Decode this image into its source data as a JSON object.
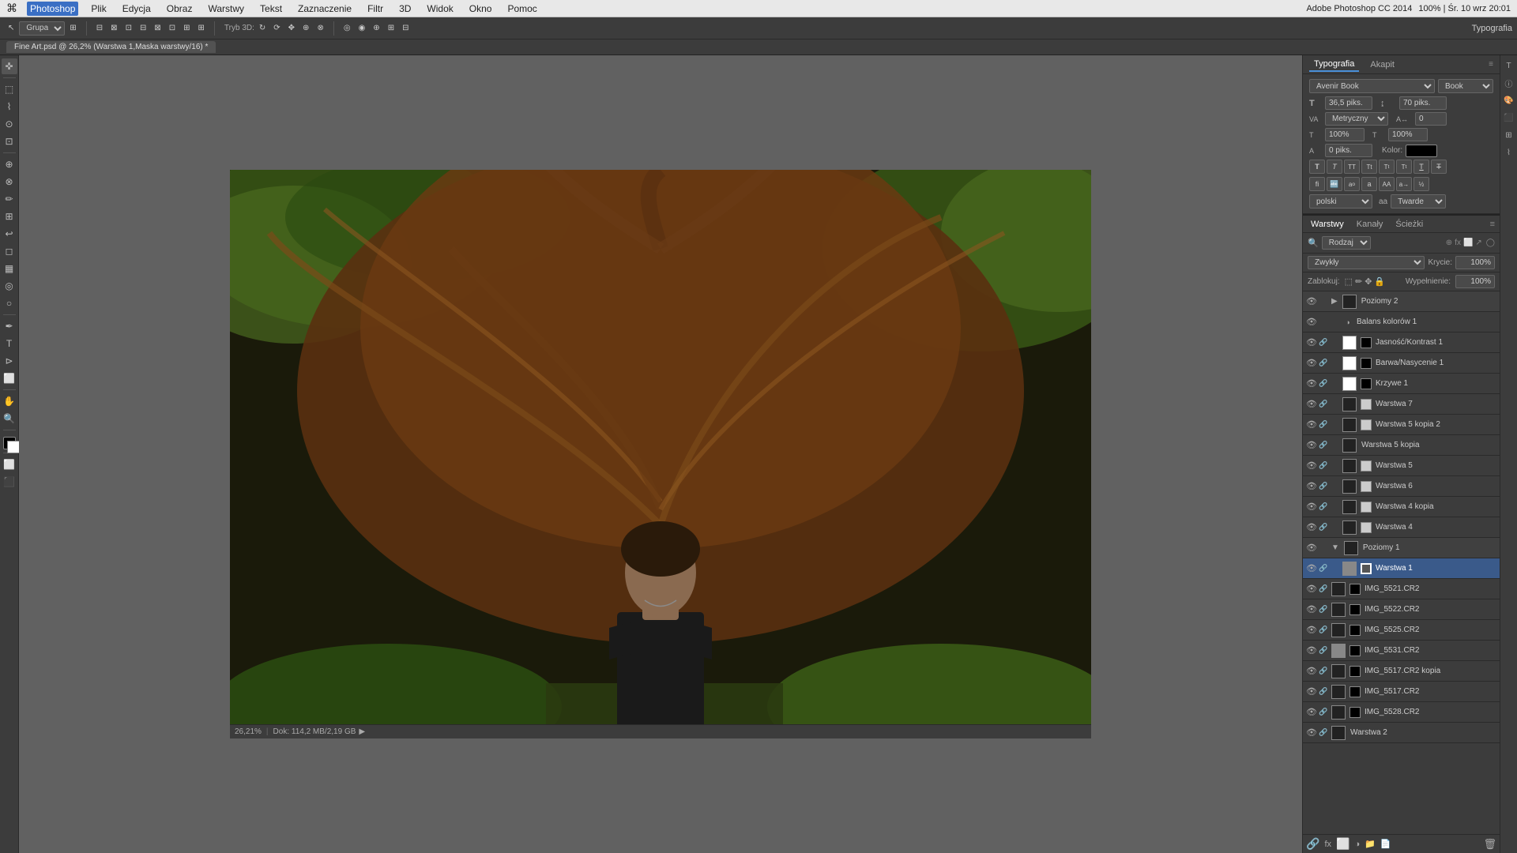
{
  "app": {
    "name": "Photoshop",
    "title": "Adobe Photoshop CC 2014",
    "workspace": "Typografia"
  },
  "menubar": {
    "apple": "⌘",
    "items": [
      "Photoshop",
      "Plik",
      "Edycja",
      "Obraz",
      "Warstwy",
      "Tekst",
      "Zaznaczenie",
      "Filtr",
      "3D",
      "Widok",
      "Okno",
      "Pomoc"
    ],
    "right": "100% | Śr. 10 wrz 20:01"
  },
  "toolbar": {
    "mode": "Tryb 3D:",
    "group_label": "Grupa"
  },
  "doctab": {
    "label": "Fine Art.psd @ 26,2% (Warstwa 1,Maska warstwy/16) *"
  },
  "statusbar": {
    "zoom": "26,21%",
    "doc_info": "Dok: 114,2 MB/2,19 GB"
  },
  "typography_panel": {
    "title": "Typografia",
    "tabs": [
      "Typografia",
      "Akapit"
    ],
    "font": "Avenir Book",
    "style": "Book",
    "size": "36,5 piks.",
    "leading": "70 piks.",
    "kern": "Metryczny",
    "track": "0",
    "scale_h": "100%",
    "scale_v": "100%",
    "baseline": "0 piks.",
    "color_label": "Kolor:",
    "language": "polski",
    "aa_method": "Twarde",
    "text_styles": [
      "T",
      "T",
      "T",
      "T",
      "T",
      "T",
      "T",
      "T"
    ],
    "text_styles2": [
      "a",
      "a",
      "a",
      "a",
      "a",
      "a",
      "1/2"
    ]
  },
  "layers_panel": {
    "tabs": [
      "Warstwy",
      "Kanały",
      "Ścieżki"
    ],
    "search_placeholder": "Rodzaj",
    "blend_mode": "Zwykły",
    "opacity": "100%",
    "fill": "100%",
    "lock_label": "Zablokuj:",
    "layers": [
      {
        "name": "Poziomy 2",
        "type": "group",
        "visible": true,
        "indent": 0
      },
      {
        "name": "Balans kolorów 1",
        "type": "adjustment",
        "visible": true,
        "indent": 1
      },
      {
        "name": "Jasność/Kontrast 1",
        "type": "adjustment",
        "visible": true,
        "indent": 1,
        "has_thumb": true
      },
      {
        "name": "Barwa/Nasycenie 1",
        "type": "adjustment",
        "visible": true,
        "indent": 1,
        "has_thumb": true
      },
      {
        "name": "Krzywe 1",
        "type": "adjustment",
        "visible": true,
        "indent": 1,
        "has_thumb": true
      },
      {
        "name": "Warstwa 7",
        "type": "normal",
        "visible": true,
        "indent": 1,
        "has_mask": true
      },
      {
        "name": "Warstwa 5 kopia 2",
        "type": "normal",
        "visible": true,
        "indent": 1,
        "has_mask": true
      },
      {
        "name": "Warstwa 5 kopia",
        "type": "normal",
        "visible": true,
        "indent": 1
      },
      {
        "name": "Warstwa 5",
        "type": "normal",
        "visible": true,
        "indent": 1,
        "has_mask": true
      },
      {
        "name": "Warstwa 6",
        "type": "normal",
        "visible": true,
        "indent": 1,
        "has_mask": true
      },
      {
        "name": "Warstwa 4 kopia",
        "type": "normal",
        "visible": true,
        "indent": 1,
        "has_mask": true
      },
      {
        "name": "Warstwa 4",
        "type": "normal",
        "visible": true,
        "indent": 1,
        "has_mask": true
      },
      {
        "name": "Poziomy 1",
        "type": "group",
        "visible": true,
        "indent": 0
      },
      {
        "name": "Warstwa 1",
        "type": "normal",
        "visible": true,
        "indent": 1,
        "active": true,
        "has_mask": true
      },
      {
        "name": "IMG_5521.CR2",
        "type": "raw",
        "visible": true,
        "indent": 0
      },
      {
        "name": "IMG_5522.CR2",
        "type": "raw",
        "visible": true,
        "indent": 0
      },
      {
        "name": "IMG_5525.CR2",
        "type": "raw",
        "visible": true,
        "indent": 0
      },
      {
        "name": "IMG_5531.CR2",
        "type": "raw",
        "visible": true,
        "indent": 0
      },
      {
        "name": "IMG_5517.CR2 kopia",
        "type": "raw",
        "visible": true,
        "indent": 0
      },
      {
        "name": "IMG_5517.CR2",
        "type": "raw",
        "visible": true,
        "indent": 0
      },
      {
        "name": "IMG_5528.CR2",
        "type": "raw",
        "visible": true,
        "indent": 0
      },
      {
        "name": "Warstwa 2",
        "type": "normal",
        "visible": true,
        "indent": 0
      }
    ],
    "footer_buttons": [
      "🔗",
      "📄",
      "📁",
      "fx",
      "⬜",
      "🗑"
    ]
  }
}
